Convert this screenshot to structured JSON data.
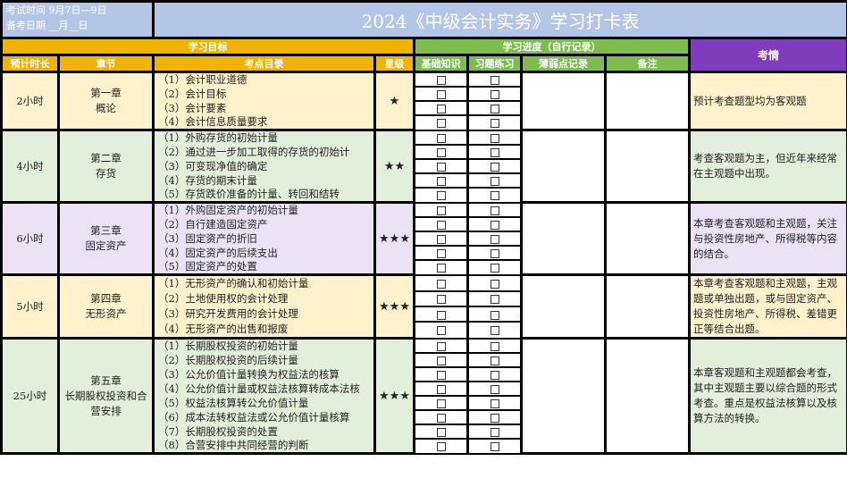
{
  "header": {
    "exam_time": "考试时间 9月7日—9日",
    "prep_date": "备考日期 __月__日",
    "title": "2024《中级会计实务》学习打卡表",
    "group_goal": "学习目标",
    "group_progress": "学习进度（自行记录）",
    "col_exam": "考情",
    "col_hours": "预计时长",
    "col_chapter": "章节",
    "col_topics": "考点目录",
    "col_stars": "星级",
    "col_basic": "基础知识",
    "col_practice": "习题练习",
    "col_weak": "薄弱点记录",
    "col_remark": "备注"
  },
  "colors": {
    "title_bg": "#b4c6e7",
    "goal_header": "#f0b400",
    "progress_header": "#7dbd4f",
    "exam_header": "#7f3dbd"
  },
  "chapters": [
    {
      "hours": "2小时",
      "chapter_no": "第一章",
      "chapter_name": "概论",
      "stars": "★",
      "bg": "#fff2cc",
      "topics": [
        "（1）会计职业道德",
        "（2）会计目标",
        "（3）会计要素",
        "（4）会计信息质量要求"
      ],
      "exam": "预计考查题型均为客观题"
    },
    {
      "hours": "4小时",
      "chapter_no": "第二章",
      "chapter_name": "存货",
      "stars": "★★",
      "bg": "#e2efda",
      "topics": [
        "（1）外购存货的初始计量",
        "（2）通过进一步加工取得的存货的初始计",
        "（3）可变现净值的确定",
        "（4）存货的期末计量",
        "（5）存货跌价准备的计量、转回和结转"
      ],
      "exam": "考查客观题为主，但近年来经常在主观题中出现。"
    },
    {
      "hours": "6小时",
      "chapter_no": "第三章",
      "chapter_name": "固定资产",
      "stars": "★★★",
      "bg": "#ebe3f5",
      "topics": [
        "（1）外购固定资产的初始计量",
        "（2）自行建造固定资产",
        "（3）固定资产的折旧",
        "（4）固定资产的后续支出",
        "（5）固定资产的处置"
      ],
      "exam": "本章考查客观题和主观题，关注与投资性房地产、所得税等内容的结合。"
    },
    {
      "hours": "5小时",
      "chapter_no": "第四章",
      "chapter_name": "无形资产",
      "stars": "★★★",
      "bg": "#fff2cc",
      "topics": [
        "（1）无形资产的确认和初始计量",
        "（2）土地使用权的会计处理",
        "（3）研究开发费用的会计处理",
        "（4）无形资产的出售和报废"
      ],
      "exam": "本章考查客观题和主观题，主观题或单独出题，或与固定资产、投资性房地产、所得税、差错更正等结合出题。"
    },
    {
      "hours": "25小时",
      "chapter_no": "第五章",
      "chapter_name": "长期股权投资和合营安排",
      "stars": "★★★",
      "bg": "#e2efda",
      "topics": [
        "（1）长期股权投资的初始计量",
        "（2）长期股权投资的后续计量",
        "（3）公允价值计量转换为权益法的核算",
        "（4）公允价值计量或权益法核算转成本法核",
        "（5）权益法核算转公允价值计量",
        "（6）成本法转权益法或公允价值计量核算",
        "（7）长期股权投资的处置",
        "（8）合营安排中共同经营的判断"
      ],
      "exam": "本章客观题和主观题都会考查，其中主观题主要以综合题的形式考查。重点是权益法核算以及核算方法的转换。"
    }
  ]
}
